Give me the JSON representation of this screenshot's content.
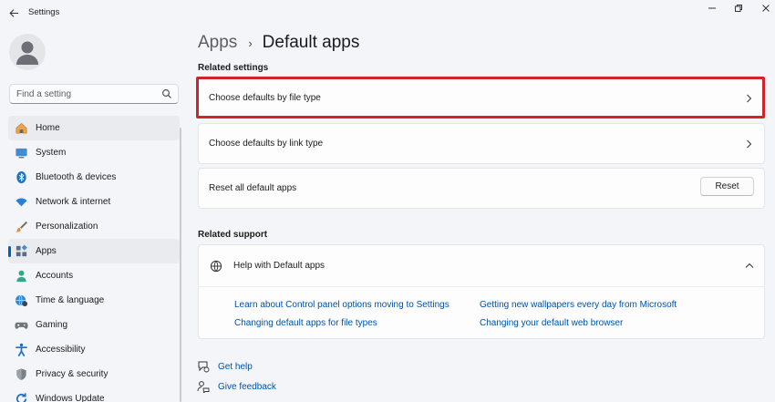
{
  "window": {
    "title": "Settings"
  },
  "search": {
    "placeholder": "Find a setting"
  },
  "sidebar": {
    "items": [
      {
        "label": "Home",
        "icon": "home-icon",
        "active": false
      },
      {
        "label": "System",
        "icon": "system-icon",
        "active": false
      },
      {
        "label": "Bluetooth & devices",
        "icon": "bluetooth-icon",
        "active": false
      },
      {
        "label": "Network & internet",
        "icon": "wifi-icon",
        "active": false
      },
      {
        "label": "Personalization",
        "icon": "brush-icon",
        "active": false
      },
      {
        "label": "Apps",
        "icon": "apps-icon",
        "active": true
      },
      {
        "label": "Accounts",
        "icon": "accounts-icon",
        "active": false
      },
      {
        "label": "Time & language",
        "icon": "globe-clock-icon",
        "active": false
      },
      {
        "label": "Gaming",
        "icon": "gamepad-icon",
        "active": false
      },
      {
        "label": "Accessibility",
        "icon": "accessibility-icon",
        "active": false
      },
      {
        "label": "Privacy & security",
        "icon": "shield-icon",
        "active": false
      },
      {
        "label": "Windows Update",
        "icon": "update-icon",
        "active": false
      }
    ]
  },
  "breadcrumb": {
    "parent": "Apps",
    "separator": "›",
    "current": "Default apps"
  },
  "related_settings": {
    "heading": "Related settings",
    "items": [
      {
        "label": "Choose defaults by file type"
      },
      {
        "label": "Choose defaults by link type"
      },
      {
        "label": "Reset all default apps",
        "button": "Reset"
      }
    ]
  },
  "related_support": {
    "heading": "Related support",
    "title": "Help with Default apps",
    "links": [
      "Learn about Control panel options moving to Settings",
      "Getting new wallpapers every day from Microsoft",
      "Changing default apps for file types",
      "Changing your default web browser"
    ]
  },
  "footer": {
    "get_help": "Get help",
    "give_feedback": "Give feedback"
  },
  "colors": {
    "accent": "#005fb8",
    "link": "#0052a3",
    "highlight_border": "#d3232a"
  }
}
